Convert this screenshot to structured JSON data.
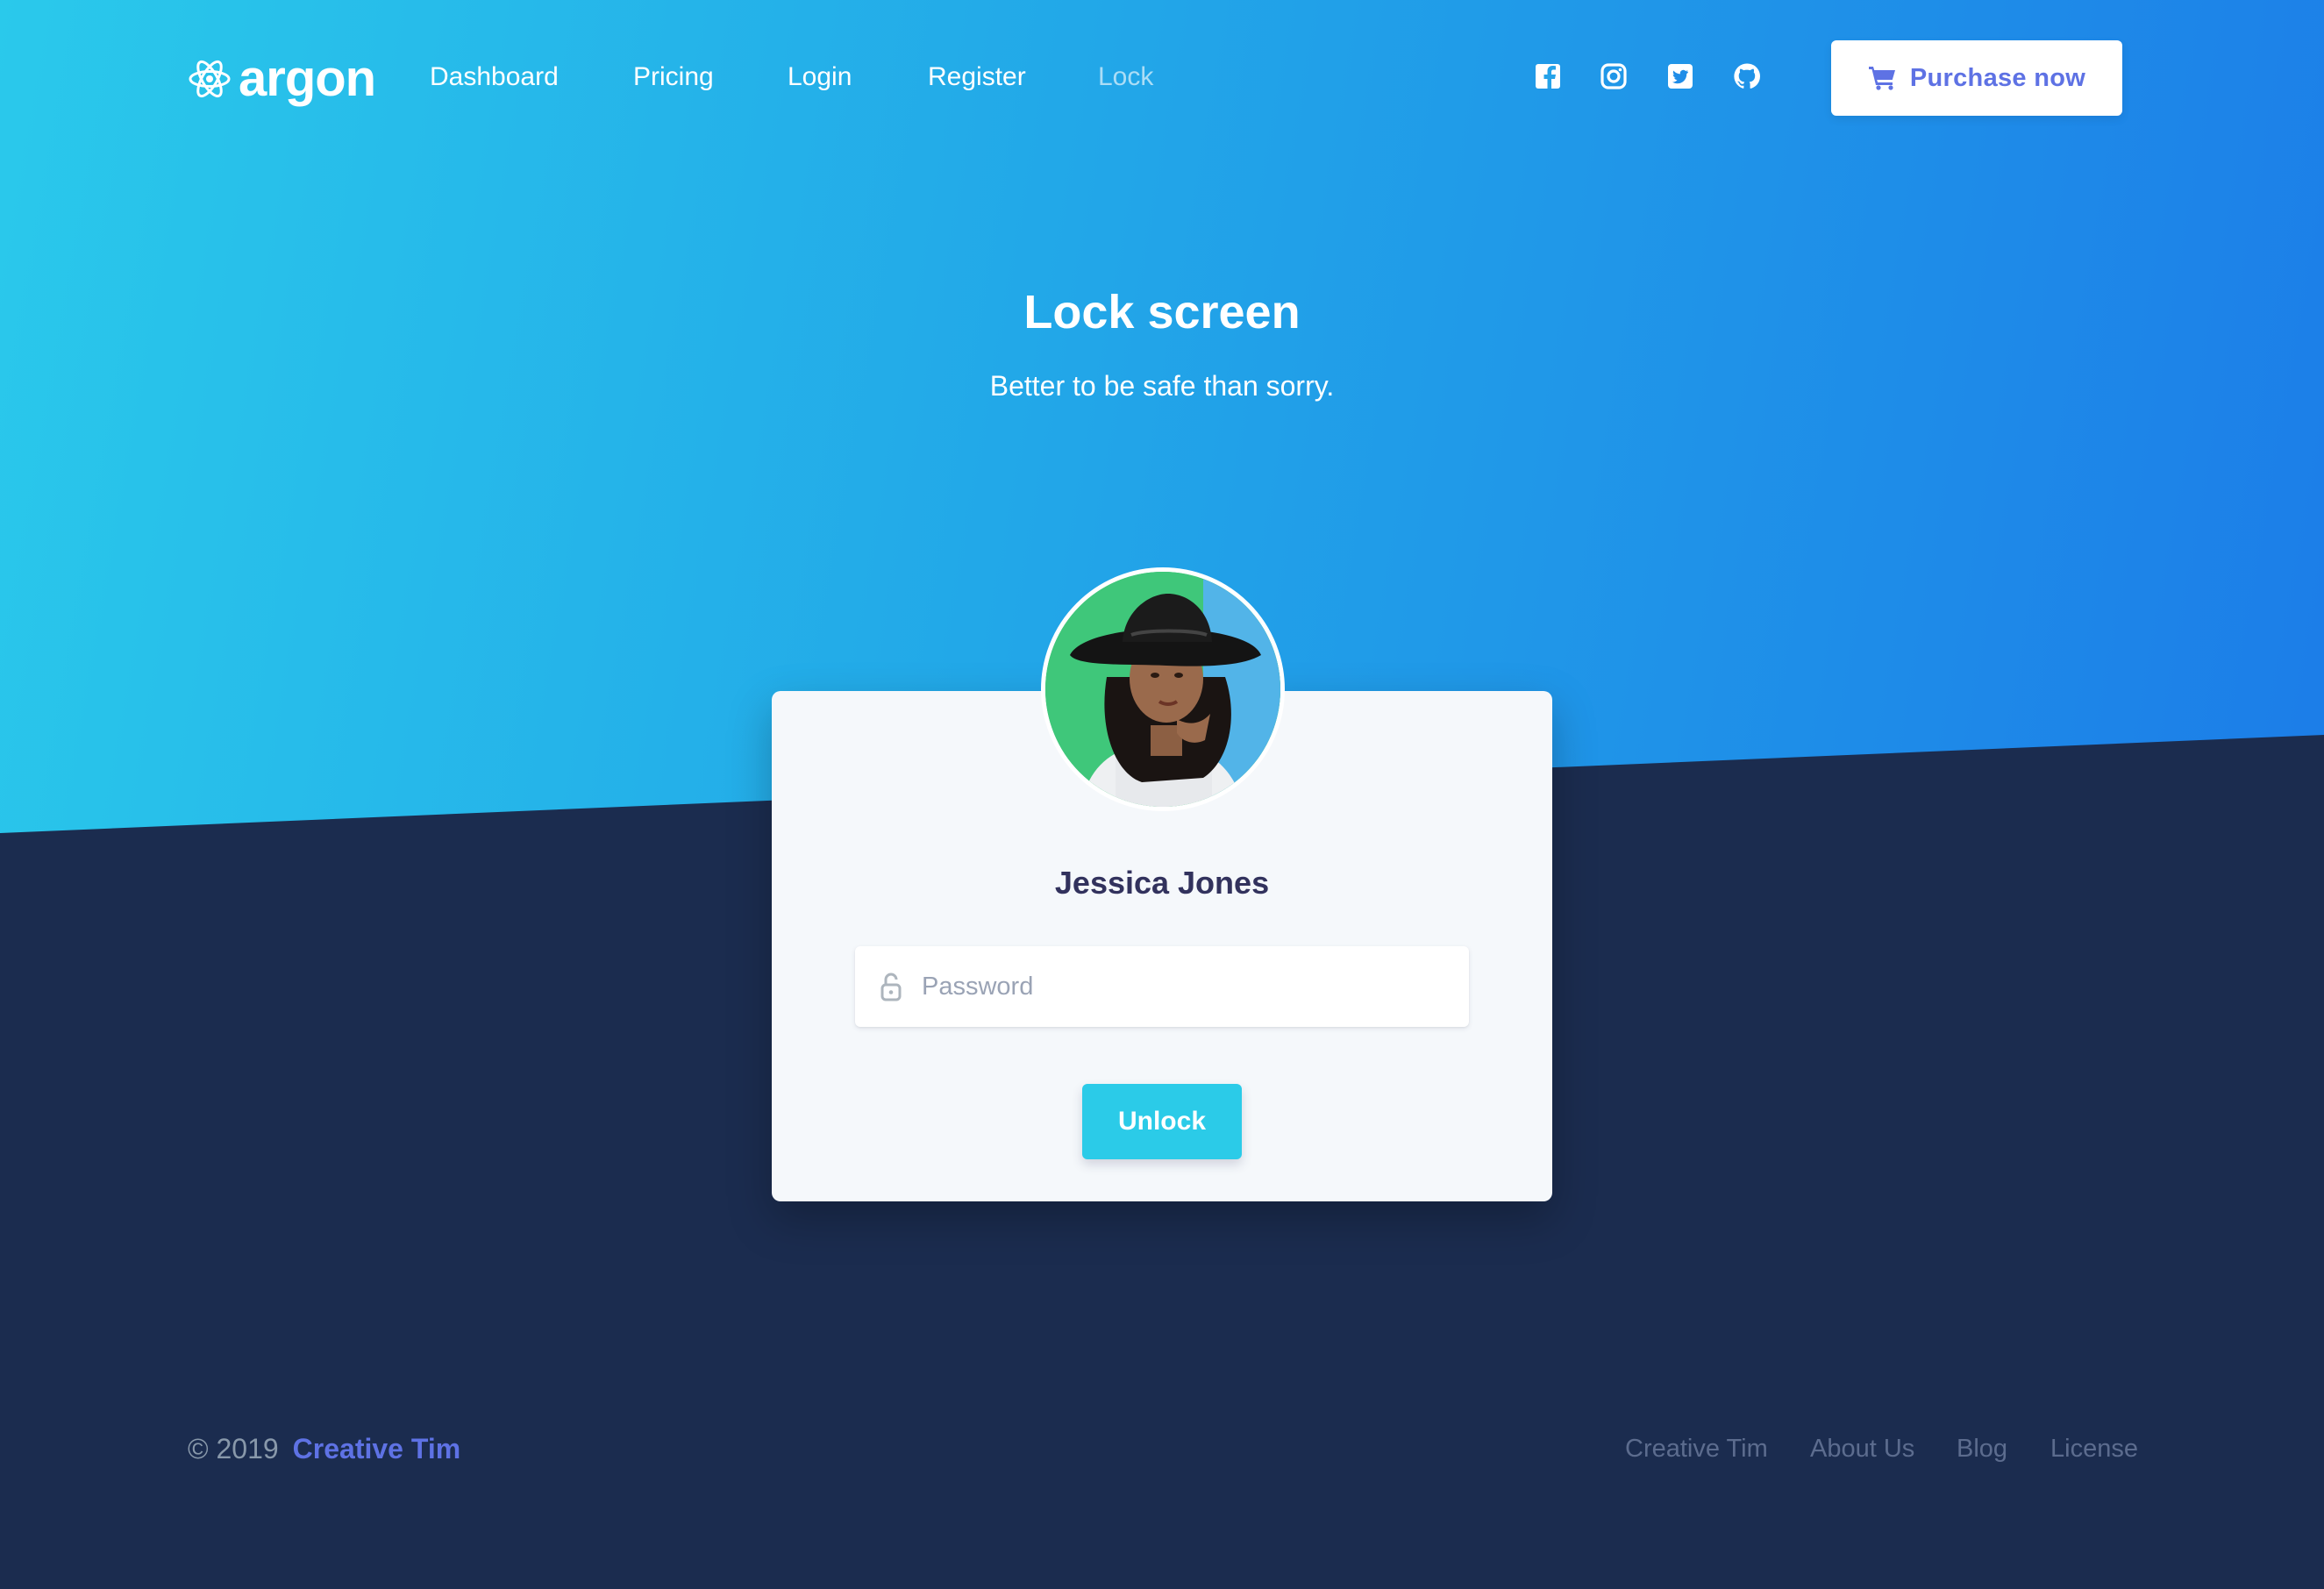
{
  "brand": {
    "name": "argon"
  },
  "nav": {
    "links": [
      {
        "label": "Dashboard"
      },
      {
        "label": "Pricing"
      },
      {
        "label": "Login"
      },
      {
        "label": "Register"
      },
      {
        "label": "Lock"
      }
    ],
    "social": [
      "facebook-icon",
      "instagram-icon",
      "twitter-icon",
      "github-icon"
    ],
    "purchase_label": "Purchase now"
  },
  "hero": {
    "title": "Lock screen",
    "subtitle": "Better to be safe than sorry."
  },
  "lock_card": {
    "user_name": "Jessica Jones",
    "password_placeholder": "Password",
    "unlock_label": "Unlock"
  },
  "footer": {
    "copyright": "© 2019",
    "copyright_link": "Creative Tim",
    "links": [
      {
        "label": "Creative Tim"
      },
      {
        "label": "About Us"
      },
      {
        "label": "Blog"
      },
      {
        "label": "License"
      }
    ]
  },
  "colors": {
    "gradient_start": "#2ac9eb",
    "gradient_end": "#1c7de8",
    "background_dark": "#1b2c4f",
    "primary": "#5e72e4",
    "info": "#2bcbe8",
    "card_bg": "#f5f8fb"
  }
}
